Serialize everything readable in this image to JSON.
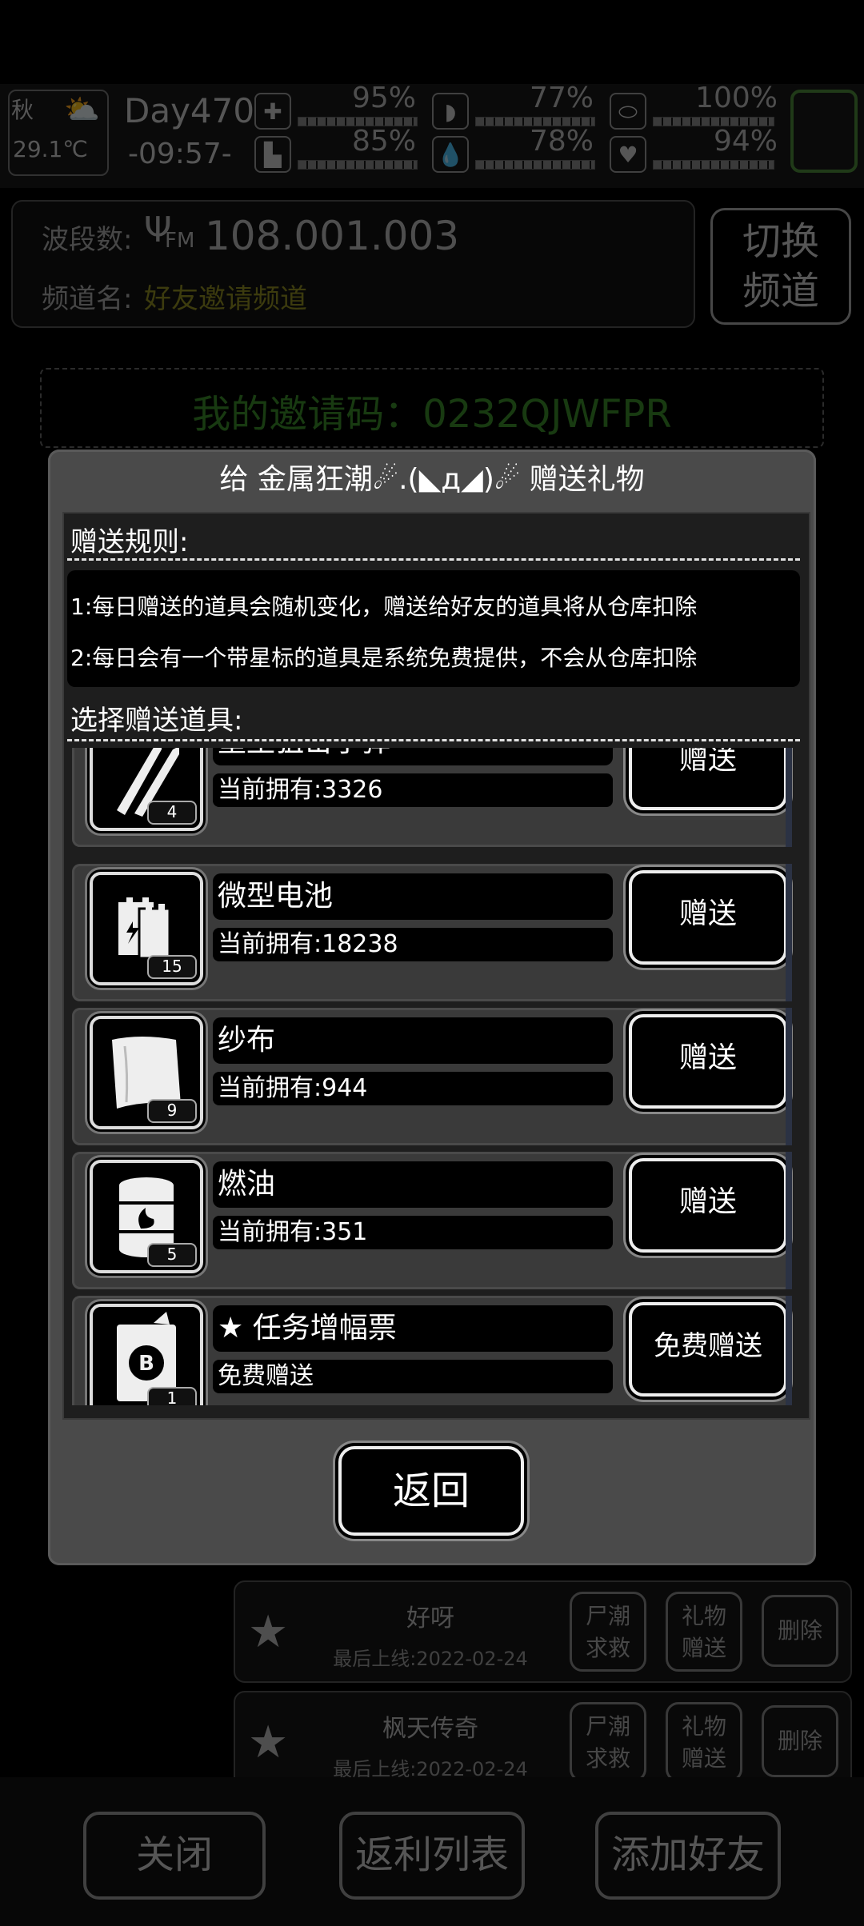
{
  "status": {
    "season": "秋",
    "temperature": "29.1℃",
    "day": "Day470",
    "time": "-09:57-",
    "stats": [
      {
        "icon": "medkit-icon",
        "value": "95%"
      },
      {
        "icon": "stomach-icon",
        "value": "77%"
      },
      {
        "icon": "shield-icon",
        "value": "100%"
      },
      {
        "icon": "boot-icon",
        "value": "85%"
      },
      {
        "icon": "water-drop-icon",
        "value": "78%"
      },
      {
        "icon": "heart-icon",
        "value": "94%"
      }
    ]
  },
  "radio": {
    "band_label": "波段数:",
    "band_value": "108.001.003",
    "fm_text": "FM",
    "channel_label": "频道名:",
    "channel_value": "好友邀请频道",
    "switch_label_1": "切换",
    "switch_label_2": "频道",
    "invite_code": "我的邀请码：0232QJWFPR"
  },
  "friends": [
    {
      "name": "好呀",
      "last_online": "最后上线:2022-02-24",
      "corpse_1": "尸潮",
      "corpse_2": "求救",
      "gift_1": "礼物",
      "gift_2": "赠送",
      "delete": "删除"
    },
    {
      "name": "枫天传奇",
      "last_online": "最后上线:2022-02-24",
      "corpse_1": "尸潮",
      "corpse_2": "求救",
      "gift_1": "礼物",
      "gift_2": "赠送",
      "delete": "删除"
    }
  ],
  "bottom": {
    "close": "关闭",
    "rebate": "返利列表",
    "add_friend": "添加好友"
  },
  "dialog": {
    "title": "给 金属狂潮☄.(◣д◢)☄ 赠送礼物",
    "rules_label": "赠送规则:",
    "rules": [
      "1:每日赠送的道具会随机变化，赠送给好友的道具将从仓库扣除",
      "2:每日会有一个带星标的道具是系统免费提供，不会从仓库扣除"
    ],
    "select_label": "选择赠送道具:",
    "items": [
      {
        "icon": "bullets-icon",
        "count": "4",
        "name": "重型狙击子弹",
        "owned": "当前拥有:3326",
        "button": "赠送"
      },
      {
        "icon": "battery-icon",
        "count": "15",
        "name": "微型电池",
        "owned": "当前拥有:18238",
        "button": "赠送"
      },
      {
        "icon": "gauze-icon",
        "count": "9",
        "name": "纱布",
        "owned": "当前拥有:944",
        "button": "赠送"
      },
      {
        "icon": "fuel-barrel-icon",
        "count": "5",
        "name": "燃油",
        "owned": "当前拥有:351",
        "button": "赠送"
      },
      {
        "icon": "ticket-icon",
        "count": "1",
        "name": "★ 任务增幅票",
        "owned": "免费赠送",
        "button": "免费赠送"
      }
    ],
    "back": "返回"
  }
}
